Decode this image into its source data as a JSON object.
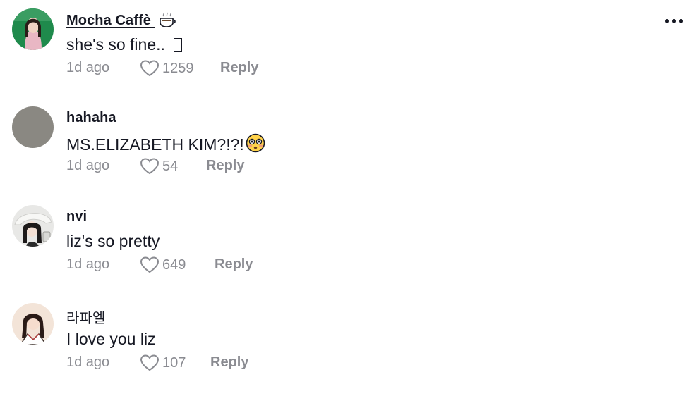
{
  "comments": [
    {
      "username": "Mocha Caffè",
      "username_emoji": "coffee-cup-icon",
      "text": "she's so fine.. ",
      "text_suffix_glyph": "missing-glyph-box",
      "time": "1d ago",
      "likes": "1259",
      "reply_label": "Reply"
    },
    {
      "username": "hahaha",
      "text": "MS.ELIZABETH KIM?!?!",
      "text_emoji": "flushed-face-icon",
      "time": "1d ago",
      "likes": "54",
      "reply_label": "Reply"
    },
    {
      "username": "nvi",
      "text": "liz's so pretty",
      "time": "1d ago",
      "likes": "649",
      "reply_label": "Reply"
    },
    {
      "username": "라파엘",
      "text": "I love you liz",
      "time": "1d ago",
      "likes": "107",
      "reply_label": "Reply"
    }
  ],
  "colors": {
    "text": "#161823",
    "meta": "#8a8b91"
  }
}
